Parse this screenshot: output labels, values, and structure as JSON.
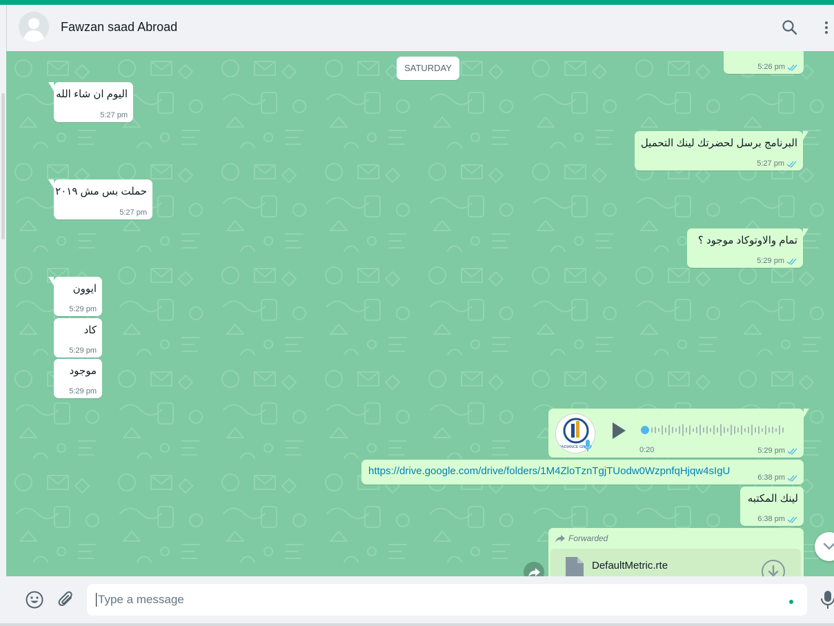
{
  "header": {
    "contact_name": "Fawzan saad Abroad"
  },
  "chat": {
    "date_chip": "SATURDAY",
    "messages": [
      {
        "id": "m0",
        "direction": "out",
        "text": "",
        "time": "5:26 pm"
      },
      {
        "id": "m1",
        "direction": "in",
        "text": "اليوم ان شاء الله",
        "time": "5:27 pm"
      },
      {
        "id": "m2",
        "direction": "out",
        "text": "البرنامج برسل لحضرتك لينك التحميل",
        "time": "5:27 pm"
      },
      {
        "id": "m3",
        "direction": "in",
        "text": "حملت بس مش ٢٠١٩",
        "time": "5:27 pm"
      },
      {
        "id": "m4",
        "direction": "out",
        "text": "تمام والاوتوكاد موجود ؟",
        "time": "5:29 pm"
      },
      {
        "id": "m5",
        "direction": "in",
        "text": "ايوون",
        "time": "5:29 pm"
      },
      {
        "id": "m6",
        "direction": "in",
        "text": "كاد",
        "time": "5:29 pm"
      },
      {
        "id": "m7",
        "direction": "in",
        "text": "موجود",
        "time": "5:29 pm"
      },
      {
        "id": "m8",
        "direction": "out",
        "type": "voice",
        "duration": "0:20",
        "time": "5:29 pm",
        "avatar_caption": "RADIANCE GROUP"
      },
      {
        "id": "m9",
        "direction": "out",
        "type": "link",
        "text": "https://drive.google.com/drive/folders/1M4ZloTznTgjTUodw0WzpnfqHjqw4sIgU",
        "time": "6:38 pm"
      },
      {
        "id": "m10",
        "direction": "out",
        "text": "لينك المكتبه",
        "time": "6:38 pm"
      },
      {
        "id": "m11",
        "direction": "out",
        "type": "file",
        "forwarded_label": "Forwarded",
        "file_name": "DefaultMetric.rte"
      }
    ]
  },
  "composer": {
    "placeholder": "Type a message"
  },
  "icons": {
    "header": [
      "avatar",
      "search-icon",
      "menu-icon"
    ],
    "composer": [
      "emoji-icon",
      "attach-icon",
      "mic-icon"
    ],
    "chat": [
      "forward-icon",
      "chevron-down-icon",
      "play-icon",
      "download-icon",
      "document-icon"
    ]
  },
  "colors": {
    "accent": "#00a884",
    "chat_background": "#7fcaa2",
    "incoming_bubble": "#ffffff",
    "outgoing_bubble": "#d9fdd3",
    "read_tick": "#53bdeb",
    "link": "#027eb5"
  }
}
